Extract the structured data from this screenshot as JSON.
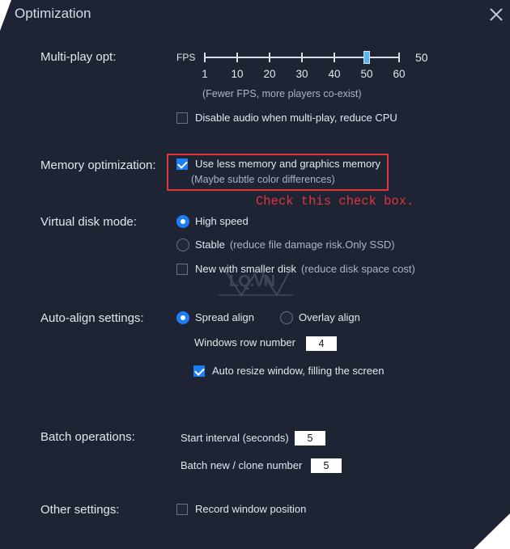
{
  "window": {
    "title": "Optimization"
  },
  "multiplay": {
    "label": "Multi-play opt:",
    "fps_label": "FPS",
    "fps_value": "50",
    "ticks": [
      "1",
      "10",
      "20",
      "30",
      "40",
      "50",
      "60"
    ],
    "selected_tick": "50",
    "hint": "(Fewer FPS, more players co-exist)",
    "disable_audio": {
      "label": "Disable audio when multi-play, reduce CPU",
      "checked": false
    }
  },
  "memory": {
    "label": "Memory optimization:",
    "option": {
      "label": "Use less memory and graphics memory",
      "checked": true
    },
    "hint": "(Maybe subtle color differences)"
  },
  "annotation": {
    "text": "Check this check box.",
    "color": "#e0363b"
  },
  "disk": {
    "label": "Virtual disk mode:",
    "high_speed": {
      "label": "High speed",
      "selected": true
    },
    "stable": {
      "label": "Stable",
      "note": "(reduce file damage risk.Only SSD)",
      "selected": false
    },
    "smaller": {
      "label": "New with smaller disk",
      "note": "(reduce disk space cost)",
      "checked": false
    }
  },
  "align": {
    "label": "Auto-align settings:",
    "spread": {
      "label": "Spread align",
      "selected": true
    },
    "overlay": {
      "label": "Overlay align",
      "selected": false
    },
    "row_label": "Windows row number",
    "row_value": "4",
    "auto_resize": {
      "label": "Auto resize window, filling the screen",
      "checked": true
    }
  },
  "batch": {
    "label": "Batch operations:",
    "interval_label": "Start interval (seconds)",
    "interval_value": "5",
    "clone_label": "Batch new / clone number",
    "clone_value": "5"
  },
  "other": {
    "label": "Other settings:",
    "record": {
      "label": "Record window position",
      "checked": false
    }
  },
  "watermark": {
    "text": "LQ.VN"
  },
  "colors": {
    "background": "#1f2434",
    "accent": "#1d7ef3",
    "annotation": "#e0363b"
  }
}
